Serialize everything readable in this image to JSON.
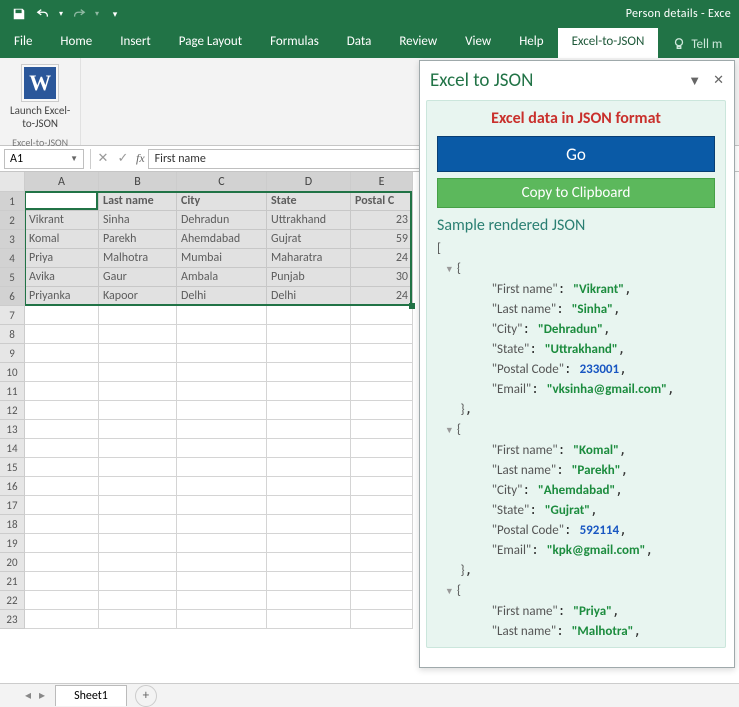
{
  "title": "Person details  -  Exce",
  "qat": {
    "save": "save-icon",
    "undo": "undo-icon",
    "redo": "redo-icon"
  },
  "tabs": [
    "File",
    "Home",
    "Insert",
    "Page Layout",
    "Formulas",
    "Data",
    "Review",
    "View",
    "Help",
    "Excel-to-JSON"
  ],
  "active_tab": "Excel-to-JSON",
  "tellme": "Tell m",
  "ribbon": {
    "group_name": "Excel-to-JSON",
    "button_label_l1": "Launch Excel-",
    "button_label_l2": "to-JSON"
  },
  "namebox": "A1",
  "formula": "First name",
  "columns": [
    {
      "label": "A",
      "w": 74
    },
    {
      "label": "B",
      "w": 78
    },
    {
      "label": "C",
      "w": 90
    },
    {
      "label": "D",
      "w": 84
    },
    {
      "label": "E",
      "w": 62
    }
  ],
  "headers": [
    "First name",
    "Last name",
    "City",
    "State",
    "Postal C"
  ],
  "rows": [
    [
      "Vikrant",
      "Sinha",
      "Dehradun",
      "Uttrakhand",
      "23"
    ],
    [
      "Komal",
      "Parekh",
      "Ahemdabad",
      "Gujrat",
      "59"
    ],
    [
      "Priya",
      "Malhotra",
      "Mumbai",
      "Maharatra",
      "24"
    ],
    [
      "Avika",
      "Gaur",
      "Ambala",
      "Punjab",
      "30"
    ],
    [
      "Priyanka",
      "Kapoor",
      "Delhi",
      "Delhi",
      "24"
    ]
  ],
  "total_row_headers": 23,
  "sheet_tab": "Sheet1",
  "pane": {
    "title": "Excel to JSON",
    "card_header": "Excel data in JSON format",
    "go": "Go",
    "copy": "Copy to Clipboard",
    "sub": "Sample rendered JSON",
    "json_records": [
      {
        "First name": "Vikrant",
        "Last name": "Sinha",
        "City": "Dehradun",
        "State": "Uttrakhand",
        "Postal Code": 233001,
        "Email": "vksinha@gmail.com"
      },
      {
        "First name": "Komal",
        "Last name": "Parekh",
        "City": "Ahemdabad",
        "State": "Gujrat",
        "Postal Code": 592114,
        "Email": "kpk@gmail.com"
      },
      {
        "First name": "Priya",
        "Last name": "Malhotra"
      }
    ]
  }
}
